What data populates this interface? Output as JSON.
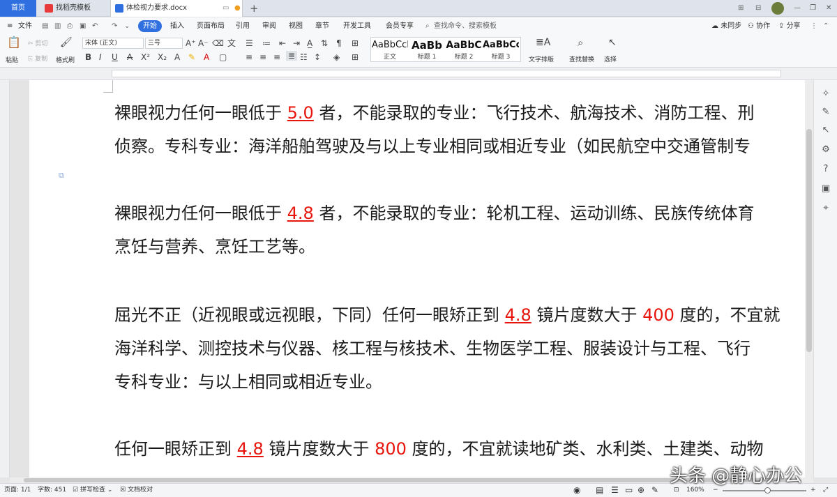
{
  "tabs": {
    "home": "首页",
    "template": "找稻壳模板",
    "document": "体检视力要求.docx",
    "new_tab": "+"
  },
  "menu": {
    "file": "文件",
    "start": "开始",
    "insert": "插入",
    "layout": "页面布局",
    "reference": "引用",
    "review": "审阅",
    "view": "视图",
    "chapter": "章节",
    "devtools": "开发工具",
    "member": "会员专享",
    "search_placeholder": "查找命令、搜索模板",
    "sync": "未同步",
    "collab": "协作",
    "share": "分享"
  },
  "ribbon": {
    "paste": "粘贴",
    "cut": "剪切",
    "copy": "复制",
    "format_painter": "格式刷",
    "font_name": "宋体 (正文)",
    "font_size": "三号",
    "styles": [
      {
        "preview": "AaBbCcDd",
        "name": "正文"
      },
      {
        "preview": "AaBb",
        "name": "标题 1"
      },
      {
        "preview": "AaBbC",
        "name": "标题 2"
      },
      {
        "preview": "AaBbCcDd",
        "name": "标题 3"
      }
    ],
    "text_layout": "文字排版",
    "find_replace": "查找替换",
    "select": "选择"
  },
  "document": {
    "p1a": "裸眼视力任何一眼低于 ",
    "p1n": "5.0",
    "p1b": " 者，不能录取的专业：飞行技术、航海技术、消防工程、刑",
    "p1c": "侦察。专科专业：海洋船舶驾驶及与以上专业相同或相近专业（如民航空中交通管制专",
    "p2a": "裸眼视力任何一眼低于 ",
    "p2n": "4.8",
    "p2b": " 者，不能录取的专业：轮机工程、运动训练、民族传统体育",
    "p2c": "烹饪与营养、烹饪工艺等。",
    "p3a": "屈光不正（近视眼或远视眼，下同）任何一眼矫正到 ",
    "p3n": "4.8",
    "p3b": " 镜片度数大于 ",
    "p3m": "400",
    "p3c": " 度的，不宜就",
    "p3d": "海洋科学、测控技术与仪器、核工程与核技术、生物医学工程、服装设计与工程、飞行",
    "p3e": "专科专业：与以上相同或相近专业。",
    "p4a": "任何一眼矫正到 ",
    "p4n": "4.8",
    "p4b": " 镜片度数大于 ",
    "p4m": "800",
    "p4c": " 度的，不宜就读地矿类、水利类、土建类、动物"
  },
  "status": {
    "page": "页面: 1/1",
    "words": "字数: 451",
    "spell": "拼写检查",
    "proofread": "文档校对",
    "zoom": "160%"
  },
  "watermark": "头条 @静心办公",
  "colors": {
    "accent": "#2f6fe0",
    "highlight": "#e8150c"
  }
}
